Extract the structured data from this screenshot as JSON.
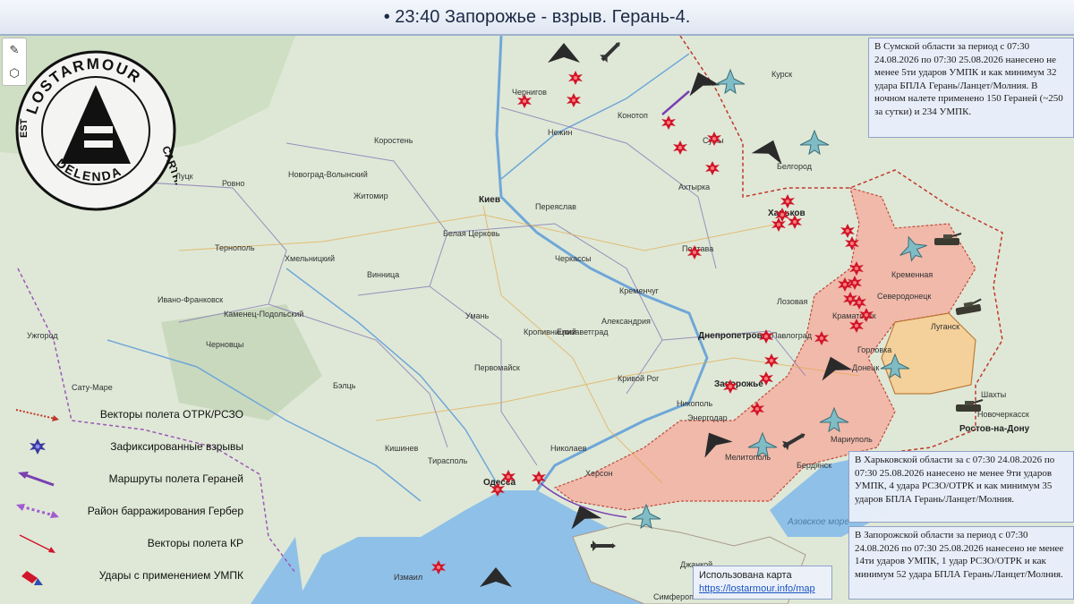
{
  "title": "• 23:40 Запорожье - взрыв. Герань-4.",
  "logo": {
    "ring_text_top": "LOSTARMOUR",
    "ring_text_right": "CARTHAGO",
    "ring_text_bottom": "DELENDA",
    "ring_text_left": "EST"
  },
  "tools": {
    "draw_icon": "pencil-icon",
    "shape_icon": "hexagon-icon"
  },
  "info_boxes": {
    "sumy": "В Сумской области за период с 07:30 24.08.2026 по 07:30 25.08.2026 нанесено не менее 5ти ударов УМПК и как минимум 32 удара БПЛА Герань/Ланцет/Молния. В ночном налете применено 150 Гераней (~250 за сутки) и 234 УМПК.",
    "kharkov": "В Харьковской области за с 07:30 24.08.2026 по 07:30 25.08.2026 нанесено не менее 9ти ударов УМПК, 4 удара РСЗО/ОТРК и как минимум 35 ударов БПЛА Герань/Ланцет/Молния.",
    "zaporozhye": "В Запорожской области за период с 07:30 24.08.2026 по 07:30 25.08.2026 нанесено не менее 14ти ударов УМПК, 1 удар РСЗО/ОТРК и как минимум 52 удара БПЛА Герань/Ланцет/Молния."
  },
  "legend": [
    {
      "label": "Векторы полета ОТРК/РСЗО",
      "icon": "dotted-red-arrow"
    },
    {
      "label": "Зафиксированные взрывы",
      "icon": "explosion-icon"
    },
    {
      "label": "Маршруты полета Гераней",
      "icon": "purple-arrow"
    },
    {
      "label": "Район барражирования Гербер",
      "icon": "purple-dotted-double-arrow"
    },
    {
      "label": "Векторы полета КР",
      "icon": "red-thin-arrow"
    },
    {
      "label": "Удары с применением УМПК",
      "icon": "red-blue-bomb-icon"
    }
  ],
  "source": {
    "label": "Использована карта",
    "link": "https://lostarmour.info/map"
  },
  "sea_labels": {
    "azov": "Азовское море"
  },
  "cities": [
    {
      "name": "Киев",
      "big": true
    },
    {
      "name": "Харьков",
      "big": true
    },
    {
      "name": "Сумы",
      "big": false
    },
    {
      "name": "Чернигов",
      "big": false
    },
    {
      "name": "Конотоп",
      "big": false
    },
    {
      "name": "Нежин",
      "big": false
    },
    {
      "name": "Курск",
      "big": false
    },
    {
      "name": "Белгород",
      "big": false
    },
    {
      "name": "Полтава",
      "big": false
    },
    {
      "name": "Кременчуг",
      "big": false
    },
    {
      "name": "Черкассы",
      "big": false
    },
    {
      "name": "Житомир",
      "big": false
    },
    {
      "name": "Белая Церковь",
      "big": false
    },
    {
      "name": "Винница",
      "big": false
    },
    {
      "name": "Хмельницкий",
      "big": false
    },
    {
      "name": "Тернополь",
      "big": false
    },
    {
      "name": "Ровно",
      "big": false
    },
    {
      "name": "Луцк",
      "big": false
    },
    {
      "name": "Ивано-Франковск",
      "big": false
    },
    {
      "name": "Коростень",
      "big": false
    },
    {
      "name": "Умань",
      "big": false
    },
    {
      "name": "Первомайск",
      "big": false
    },
    {
      "name": "Александрия",
      "big": false
    },
    {
      "name": "Кропивницкий",
      "big": false
    },
    {
      "name": "Елизаветград",
      "big": false
    },
    {
      "name": "Днепропетровск",
      "big": true
    },
    {
      "name": "Кривой Рог",
      "big": false
    },
    {
      "name": "Никополь",
      "big": false
    },
    {
      "name": "Запорожье",
      "big": true
    },
    {
      "name": "Мелитополь",
      "big": false
    },
    {
      "name": "Бердянск",
      "big": false
    },
    {
      "name": "Мариуполь",
      "big": false
    },
    {
      "name": "Энергодар",
      "big": false
    },
    {
      "name": "Николаев",
      "big": false
    },
    {
      "name": "Херсон",
      "big": false
    },
    {
      "name": "Одесса",
      "big": true
    },
    {
      "name": "Тирасполь",
      "big": false
    },
    {
      "name": "Кишинев",
      "big": false
    },
    {
      "name": "Измаил",
      "big": false
    },
    {
      "name": "Павлоград",
      "big": false
    },
    {
      "name": "Лозовая",
      "big": false
    },
    {
      "name": "Краматорск",
      "big": false
    },
    {
      "name": "Северодонецк",
      "big": false
    },
    {
      "name": "Луганск",
      "big": false
    },
    {
      "name": "Горловка",
      "big": false
    },
    {
      "name": "Донецк",
      "big": false
    },
    {
      "name": "Шахты",
      "big": false
    },
    {
      "name": "Новочеркасск",
      "big": false
    },
    {
      "name": "Ростов-на-Дону",
      "big": true
    },
    {
      "name": "Симферополь",
      "big": false
    },
    {
      "name": "Джанкой",
      "big": false
    },
    {
      "name": "Ужгород",
      "big": false
    },
    {
      "name": "Сату-Маре",
      "big": false
    },
    {
      "name": "Бэлць",
      "big": false
    },
    {
      "name": "Черновцы",
      "big": false
    },
    {
      "name": "Каменец-Подольский",
      "big": false
    },
    {
      "name": "Новоград-Волынский",
      "big": false
    },
    {
      "name": "Переяслав",
      "big": false
    },
    {
      "name": "Ахтырка",
      "big": false
    },
    {
      "name": "Кременная",
      "big": false
    }
  ],
  "colors": {
    "occupied_zone": "#f2b4a6",
    "lugansk_zone": "#f7cf94",
    "sea": "#8fc0e8",
    "land": "#dfe8d7",
    "explosion": "#d0162a",
    "border": "#c0392b",
    "title_text": "#1b2a44"
  }
}
